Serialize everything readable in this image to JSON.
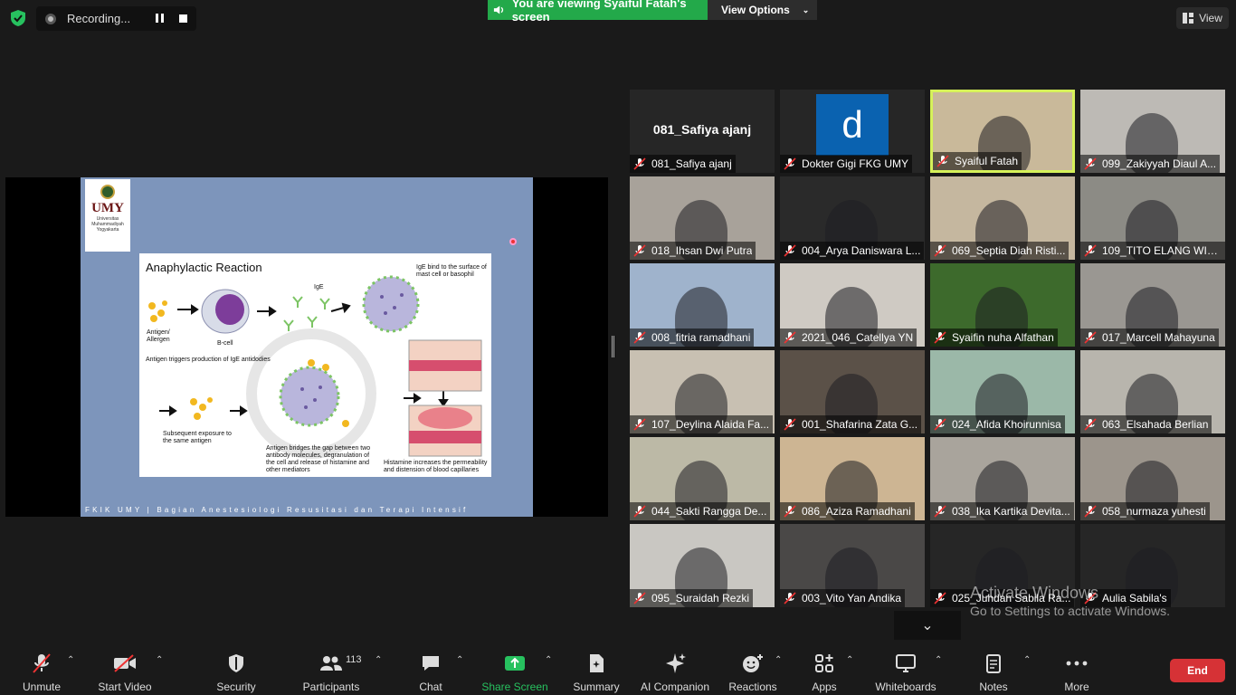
{
  "top": {
    "recording_label": "Recording...",
    "viewing_banner": "You are viewing Syaiful Fatah's screen",
    "view_options": "View Options",
    "view_button": "View"
  },
  "slide": {
    "logo_text": "UMY",
    "logo_sub": "Universitas Muhammadiyah Yogyakarta",
    "title": "Anaphylactic Reaction",
    "labels": {
      "ige_surface": "IgE bind to the surface of mast cell or basophil",
      "ige": "IgE",
      "antigen_allergen": "Antigen/ Allergen",
      "bcell": "B-cell",
      "antigen_triggers": "Antigen triggers production of IgE antidodies",
      "subsequent": "Subsequent exposure to the same antigen",
      "bridges": "Antigen bridges the gap between two antibody molecules, degranulation of the cell and release of histamine and other mediators",
      "histamine": "Histamine increases the permeability and distension of blood capillaries"
    },
    "footer": "FKIK UMY | Bagian Anestesiologi Resusitasi dan Terapi Intensif"
  },
  "participants": [
    {
      "name": "081_Safiya ajanj",
      "big_name": "081_Safiya ajanj",
      "bg": "#262626"
    },
    {
      "name": "Dokter Gigi FKG UMY",
      "avatar_letter": "d",
      "bg": "#262626"
    },
    {
      "name": "Syaiful Fatah",
      "bg": "#c9b99a",
      "active": true
    },
    {
      "name": "099_Zakiyyah Diaul A...",
      "bg": "#bdbab5"
    },
    {
      "name": "018_Ihsan Dwi Putra",
      "bg": "#a8a29a"
    },
    {
      "name": "004_Arya Daniswara L...",
      "bg": "#2a2a2a"
    },
    {
      "name": "069_Septia Diah Risti...",
      "bg": "#c5b79f"
    },
    {
      "name": "109_TITO ELANG WIBI...",
      "bg": "#8c8b85"
    },
    {
      "name": "008_fitria ramadhani",
      "bg": "#9fb3cc"
    },
    {
      "name": "2021_046_Catellya YN",
      "bg": "#cfcac3"
    },
    {
      "name": "Syaifin nuha Alfathan",
      "bg": "#3d6a2c"
    },
    {
      "name": "017_Marcell Mahayuna",
      "bg": "#9a9792"
    },
    {
      "name": "107_Deylina Alaida Fa...",
      "bg": "#c8c0b2"
    },
    {
      "name": "001_Shafarina Zata G...",
      "bg": "#5b5148"
    },
    {
      "name": "024_Afida Khoirunnisa",
      "bg": "#9bb8a8"
    },
    {
      "name": "063_Elsahada Berlian",
      "bg": "#b8b5ad"
    },
    {
      "name": "044_Sakti Rangga De...",
      "bg": "#bcb9a6"
    },
    {
      "name": "086_Aziza Ramadhani",
      "bg": "#cdb593"
    },
    {
      "name": "038_Ika Kartika Devita...",
      "bg": "#a9a49c"
    },
    {
      "name": "058_nurmaza yuhesti",
      "bg": "#9c958c"
    },
    {
      "name": "095_Suraidah Rezki",
      "bg": "#c9c7c2"
    },
    {
      "name": "003_Vito Yan Andika",
      "bg": "#4a4847"
    },
    {
      "name": "025_Juhdan Sabila Ra...",
      "bg": "#262626"
    },
    {
      "name": "Aulia Sabila's",
      "bg": "#262626"
    }
  ],
  "overlay": {
    "activate_line1": "Activate Windows",
    "activate_line2": "Go to Settings to activate Windows."
  },
  "toolbar": {
    "unmute": "Unmute",
    "start_video": "Start Video",
    "security": "Security",
    "participants": "Participants",
    "participant_count": "113",
    "chat": "Chat",
    "share_screen": "Share Screen",
    "summary": "Summary",
    "ai_companion": "AI Companion",
    "reactions": "Reactions",
    "apps": "Apps",
    "whiteboards": "Whiteboards",
    "notes": "Notes",
    "more": "More",
    "end": "End"
  },
  "colors": {
    "accent_green": "#23a94a",
    "end_red": "#d63236",
    "active_speaker": "#d6f15a"
  }
}
